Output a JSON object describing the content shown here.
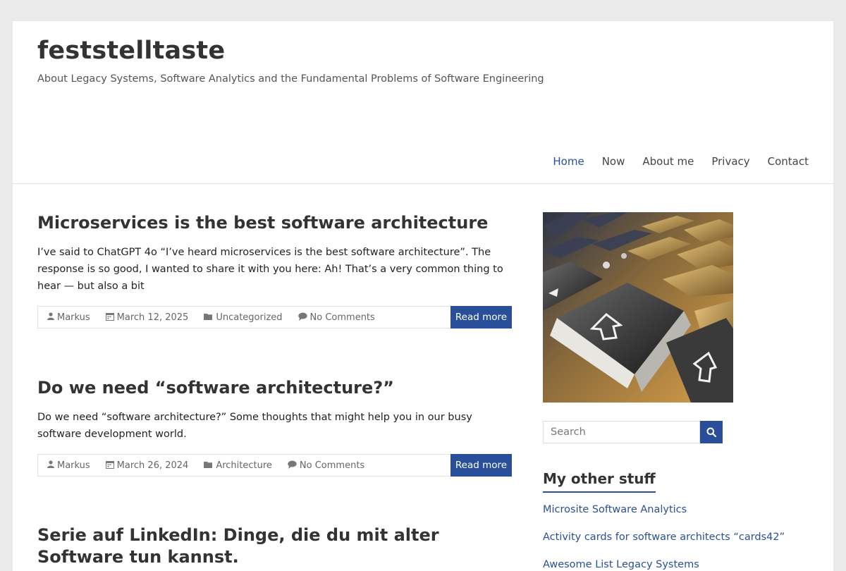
{
  "site": {
    "title": "feststelltaste",
    "tagline": "About Legacy Systems, Software Analytics and the Fundamental Problems of Software Engineering"
  },
  "nav": [
    {
      "label": "Home",
      "active": true
    },
    {
      "label": "Now"
    },
    {
      "label": "About me"
    },
    {
      "label": "Privacy"
    },
    {
      "label": "Contact"
    }
  ],
  "posts": [
    {
      "title": "Microservices is the best software architecture",
      "excerpt": "I’ve said to ChatGPT 4o “I’ve heard microservices is the best software architecture”. The response is so good, I wanted to share it with you here:   Ah! That’s a very common thing to hear — but also a bit",
      "author": "Markus",
      "date": "March 12, 2025",
      "category": "Uncategorized",
      "comments": "No Comments",
      "read_more": "Read more"
    },
    {
      "title": "Do we need “software architecture?”",
      "excerpt": "Do we need “software architecture?” Some thoughts that might help you in our busy software development world.",
      "author": "Markus",
      "date": "March 26, 2024",
      "category": "Architecture",
      "comments": "No Comments",
      "read_more": "Read more"
    },
    {
      "title": "Serie auf LinkedIn: Dinge, die du mit alter Software tun kannst."
    }
  ],
  "sidebar": {
    "search_placeholder": "Search",
    "widget_title": "My other stuff",
    "links": [
      "Microsite Software Analytics",
      "Activity cards for software architects “cards42”",
      "Awesome List Legacy Systems"
    ]
  },
  "icons": {
    "author": "user-icon",
    "date": "calendar-icon",
    "category": "folder-icon",
    "comments": "comment-icon",
    "search": "search-icon"
  },
  "colors": {
    "accent": "#2a4f9a",
    "background": "#eaeaea"
  }
}
